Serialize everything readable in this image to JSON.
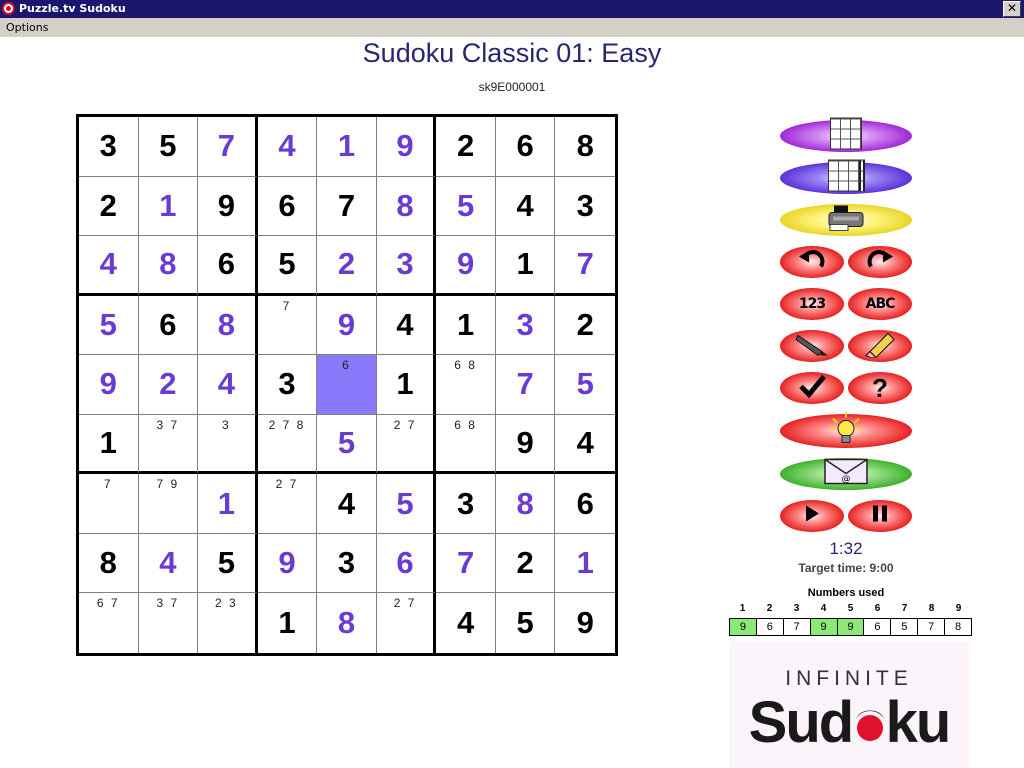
{
  "window": {
    "title": "Puzzle.tv Sudoku",
    "close_label": "✕"
  },
  "menu": {
    "options_label": "Options"
  },
  "game": {
    "title": "Sudoku Classic 01: Easy",
    "code": "sk9E000001"
  },
  "board": {
    "rows": [
      [
        {
          "v": "3",
          "t": "given"
        },
        {
          "v": "5",
          "t": "given"
        },
        {
          "v": "7",
          "t": "user"
        },
        {
          "v": "4",
          "t": "user"
        },
        {
          "v": "1",
          "t": "user"
        },
        {
          "v": "9",
          "t": "user"
        },
        {
          "v": "2",
          "t": "given"
        },
        {
          "v": "6",
          "t": "given"
        },
        {
          "v": "8",
          "t": "given"
        }
      ],
      [
        {
          "v": "2",
          "t": "given"
        },
        {
          "v": "1",
          "t": "user"
        },
        {
          "v": "9",
          "t": "given"
        },
        {
          "v": "6",
          "t": "given"
        },
        {
          "v": "7",
          "t": "given"
        },
        {
          "v": "8",
          "t": "user"
        },
        {
          "v": "5",
          "t": "user"
        },
        {
          "v": "4",
          "t": "given"
        },
        {
          "v": "3",
          "t": "given"
        }
      ],
      [
        {
          "v": "4",
          "t": "user"
        },
        {
          "v": "8",
          "t": "user"
        },
        {
          "v": "6",
          "t": "given"
        },
        {
          "v": "5",
          "t": "given"
        },
        {
          "v": "2",
          "t": "user"
        },
        {
          "v": "3",
          "t": "user"
        },
        {
          "v": "9",
          "t": "user"
        },
        {
          "v": "1",
          "t": "given"
        },
        {
          "v": "7",
          "t": "user"
        }
      ],
      [
        {
          "v": "5",
          "t": "user"
        },
        {
          "v": "6",
          "t": "given"
        },
        {
          "v": "8",
          "t": "user"
        },
        {
          "n": "7"
        },
        {
          "v": "9",
          "t": "user"
        },
        {
          "v": "4",
          "t": "given"
        },
        {
          "v": "1",
          "t": "given"
        },
        {
          "v": "3",
          "t": "user"
        },
        {
          "v": "2",
          "t": "given"
        }
      ],
      [
        {
          "v": "9",
          "t": "user"
        },
        {
          "v": "2",
          "t": "user"
        },
        {
          "v": "4",
          "t": "user"
        },
        {
          "v": "3",
          "t": "given"
        },
        {
          "n": "6",
          "sel": true
        },
        {
          "v": "1",
          "t": "given"
        },
        {
          "n": "6 8"
        },
        {
          "v": "7",
          "t": "user"
        },
        {
          "v": "5",
          "t": "user"
        }
      ],
      [
        {
          "v": "1",
          "t": "given"
        },
        {
          "n": "3 7"
        },
        {
          "n": "3"
        },
        {
          "n": "2 7 8"
        },
        {
          "v": "5",
          "t": "user"
        },
        {
          "n": "2 7"
        },
        {
          "n": "6 8"
        },
        {
          "v": "9",
          "t": "given"
        },
        {
          "v": "4",
          "t": "given"
        }
      ],
      [
        {
          "n": "7"
        },
        {
          "n": "7 9"
        },
        {
          "v": "1",
          "t": "user"
        },
        {
          "n": "2 7"
        },
        {
          "v": "4",
          "t": "given"
        },
        {
          "v": "5",
          "t": "user"
        },
        {
          "v": "3",
          "t": "given"
        },
        {
          "v": "8",
          "t": "user"
        },
        {
          "v": "6",
          "t": "given"
        }
      ],
      [
        {
          "v": "8",
          "t": "given"
        },
        {
          "v": "4",
          "t": "user"
        },
        {
          "v": "5",
          "t": "given"
        },
        {
          "v": "9",
          "t": "user"
        },
        {
          "v": "3",
          "t": "given"
        },
        {
          "v": "6",
          "t": "user"
        },
        {
          "v": "7",
          "t": "user"
        },
        {
          "v": "2",
          "t": "given"
        },
        {
          "v": "1",
          "t": "user"
        }
      ],
      [
        {
          "n": "6 7"
        },
        {
          "n": "3 7"
        },
        {
          "n": "2 3"
        },
        {
          "v": "1",
          "t": "given"
        },
        {
          "v": "8",
          "t": "user"
        },
        {
          "n": "2 7"
        },
        {
          "v": "4",
          "t": "given"
        },
        {
          "v": "5",
          "t": "given"
        },
        {
          "v": "9",
          "t": "given"
        }
      ]
    ]
  },
  "colors": {
    "given": "#000000",
    "user": "#6a3bd2",
    "selected": "#8a78fb",
    "used_complete": "#8ee878",
    "title": "#29266f"
  },
  "tools": {
    "new_puzzle_icon": "grid-icon",
    "choose_puzzle_icon": "grid-list-icon",
    "print_icon": "printer-icon",
    "undo_icon": "undo-arrow-icon",
    "redo_icon": "redo-arrow-icon",
    "numbers_label": "123",
    "letters_label": "ABC",
    "pencil_icon": "pencil-icon",
    "eraser_icon": "eraser-icon",
    "check_icon": "checkmark-icon",
    "help_icon": "question-icon",
    "hint_icon": "lightbulb-icon",
    "email_icon": "email-icon",
    "play_icon": "play-icon",
    "pause_icon": "pause-icon"
  },
  "timer": {
    "elapsed": "1:32",
    "target": "Target time: 9:00"
  },
  "numbers_used": {
    "title": "Numbers used",
    "digits": [
      "1",
      "2",
      "3",
      "4",
      "5",
      "6",
      "7",
      "8",
      "9"
    ],
    "counts": [
      {
        "c": "9",
        "done": true
      },
      {
        "c": "6",
        "done": false
      },
      {
        "c": "7",
        "done": false
      },
      {
        "c": "9",
        "done": true
      },
      {
        "c": "9",
        "done": true
      },
      {
        "c": "6",
        "done": false
      },
      {
        "c": "5",
        "done": false
      },
      {
        "c": "7",
        "done": false
      },
      {
        "c": "8",
        "done": false
      }
    ]
  },
  "logo": {
    "line1": "INFINITE",
    "line2": "Sudoku"
  }
}
